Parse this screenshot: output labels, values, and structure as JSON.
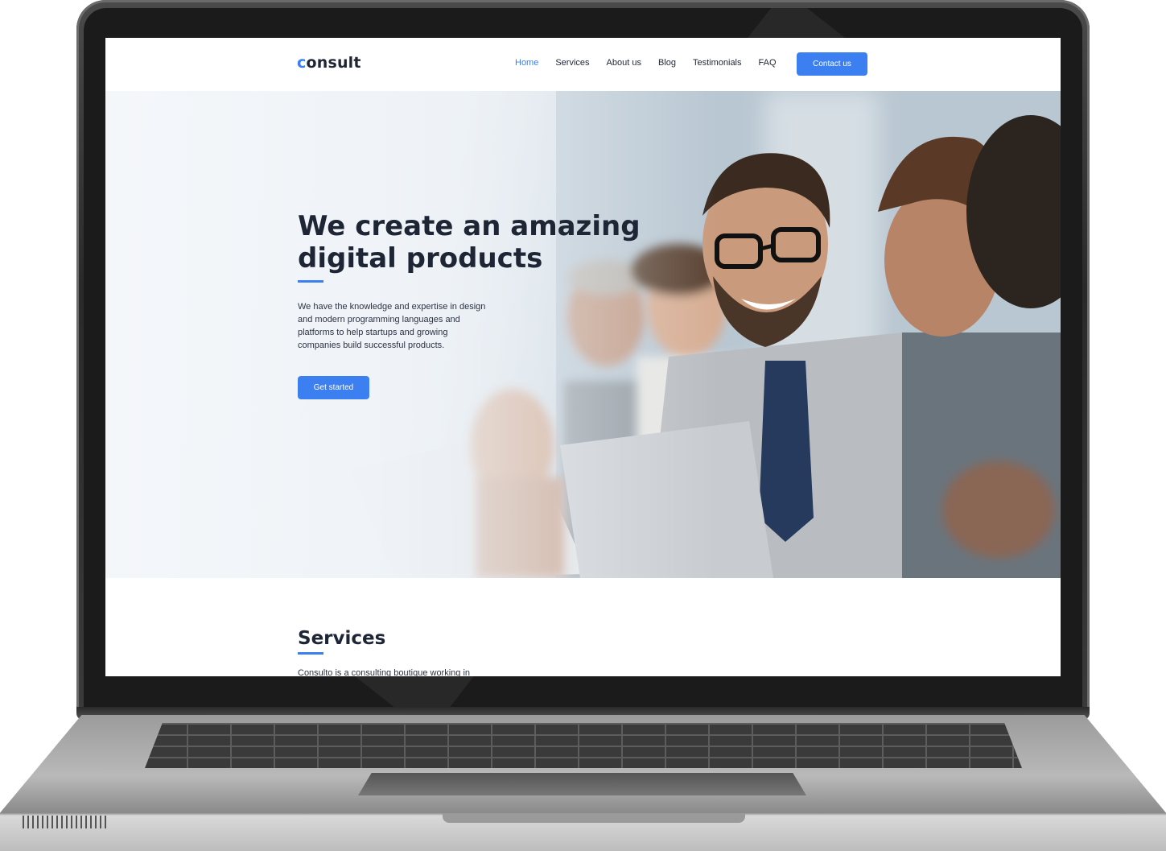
{
  "site": {
    "logo_first_letter": "c",
    "logo_rest": "onsult"
  },
  "nav": {
    "items": [
      {
        "label": "Home",
        "active": true
      },
      {
        "label": "Services",
        "active": false
      },
      {
        "label": "About us",
        "active": false
      },
      {
        "label": "Blog",
        "active": false
      },
      {
        "label": "Testimonials",
        "active": false
      },
      {
        "label": "FAQ",
        "active": false
      }
    ],
    "contact_label": "Contact us"
  },
  "hero": {
    "title": "We create an amazing digital products",
    "description": "We have the knowledge and expertise in design and modern programming languages and platforms to help startups and growing companies build successful products.",
    "cta_label": "Get started"
  },
  "services": {
    "title": "Services",
    "intro": "Consulto is a consulting boutique working in"
  },
  "colors": {
    "accent": "#3b7ff0",
    "heading": "#1e2535",
    "body_text": "#2b3242",
    "device_frame": "#2a2a2a"
  }
}
